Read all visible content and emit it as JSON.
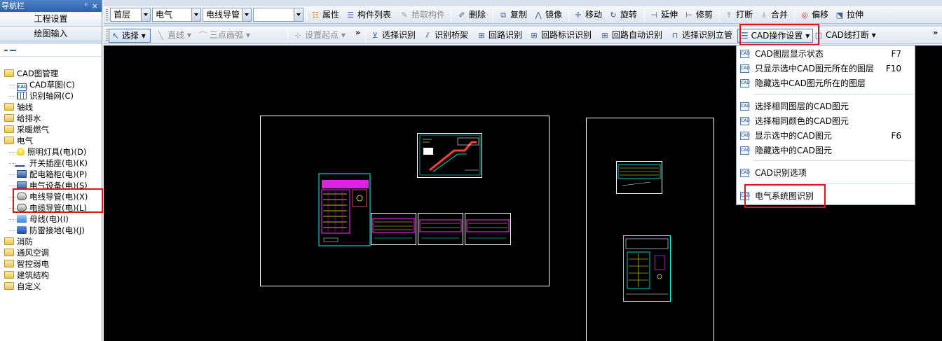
{
  "nav": {
    "title": "导航栏",
    "pin_glyph": "ᵖ",
    "close_glyph": "×",
    "buttons": [
      "工程设置",
      "绘图输入"
    ],
    "tree": [
      {
        "label": "CAD图管理",
        "kind": "folder",
        "level": 0
      },
      {
        "label": "CAD草图(C)",
        "kind": "cad",
        "level": 1
      },
      {
        "label": "识别轴网(C)",
        "kind": "grid",
        "level": 1
      },
      {
        "label": "轴线",
        "kind": "folder",
        "level": 0
      },
      {
        "label": "给排水",
        "kind": "folder",
        "level": 0
      },
      {
        "label": "采暖燃气",
        "kind": "folder",
        "level": 0
      },
      {
        "label": "电气",
        "kind": "folder",
        "level": 0
      },
      {
        "label": "照明灯具(电)(D)",
        "kind": "bulb",
        "level": 1
      },
      {
        "label": "开关插座(电)(K)",
        "kind": "switch",
        "level": 1
      },
      {
        "label": "配电箱柜(电)(P)",
        "kind": "box",
        "level": 1
      },
      {
        "label": "电气设备(电)(S)",
        "kind": "box",
        "level": 1
      },
      {
        "label": "电线导管(电)(X)",
        "kind": "pipe",
        "level": 1
      },
      {
        "label": "电缆导管(电)(L)",
        "kind": "pipe",
        "level": 1
      },
      {
        "label": "母线(电)(I)",
        "kind": "light",
        "level": 1
      },
      {
        "label": "防雷接地(电)(J)",
        "kind": "blue",
        "level": 1
      },
      {
        "label": "消防",
        "kind": "folder",
        "level": 0
      },
      {
        "label": "通风空调",
        "kind": "folder",
        "level": 0
      },
      {
        "label": "智控弱电",
        "kind": "folder",
        "level": 0
      },
      {
        "label": "建筑结构",
        "kind": "folder",
        "level": 0
      },
      {
        "label": "自定义",
        "kind": "folder",
        "level": 0
      }
    ]
  },
  "toolbar1": {
    "floor": "首层",
    "discipline": "电气",
    "component_type": "电线导管",
    "component": "",
    "properties": "属性",
    "component_list": "构件列表",
    "pick_component": "拾取构件",
    "delete": "删除",
    "copy": "复制",
    "mirror": "镜像",
    "move": "移动",
    "rotate": "旋转",
    "extend": "延伸",
    "trim": "修剪",
    "break": "打断",
    "merge": "合并",
    "offset": "偏移",
    "stretch": "拉伸"
  },
  "toolbar2": {
    "select": "选择",
    "line": "直线",
    "arc": "三点画弧",
    "set_origin": "设置起点",
    "select_recognize": "选择识别",
    "recognize_bridge": "识别桥架",
    "loop_recognize": "回路识别",
    "loop_label_recognize": "回路标识识别",
    "loop_auto_recognize": "回路自动识别",
    "select_vertical_pipe": "选择识别立管",
    "cad_operation_settings": "CAD操作设置",
    "cad_line_break": "CAD线打断",
    "overflow_glyph": "»"
  },
  "menu": {
    "items": [
      {
        "label": "CAD图层显示状态",
        "shortcut": "F7",
        "icon": "layers-icon"
      },
      {
        "label": "只显示选中CAD图元所在的图层",
        "shortcut": "F10",
        "icon": "cad-icon"
      },
      {
        "label": "隐藏选中CAD图元所在的图层",
        "shortcut": "",
        "icon": "cad-icon"
      },
      {
        "label": "选择相同图层的CAD图元",
        "shortcut": "",
        "icon": "cad-icon"
      },
      {
        "label": "选择相同颜色的CAD图元",
        "shortcut": "",
        "icon": "cad-icon"
      },
      {
        "label": "显示选中的CAD图元",
        "shortcut": "F6",
        "icon": "cad-icon"
      },
      {
        "label": "隐藏选中的CAD图元",
        "shortcut": "",
        "icon": "cad-icon"
      },
      {
        "label": "CAD识别选项",
        "shortcut": "",
        "icon": "cad-icon"
      },
      {
        "label": "电气系统图识别",
        "shortcut": "",
        "icon": "system-diagram-icon"
      }
    ]
  },
  "colors": {
    "highlight_red": "#e0141b",
    "canvas": "#000000",
    "cad_cyan": "#00ffff",
    "cad_magenta": "#ff00ff"
  }
}
